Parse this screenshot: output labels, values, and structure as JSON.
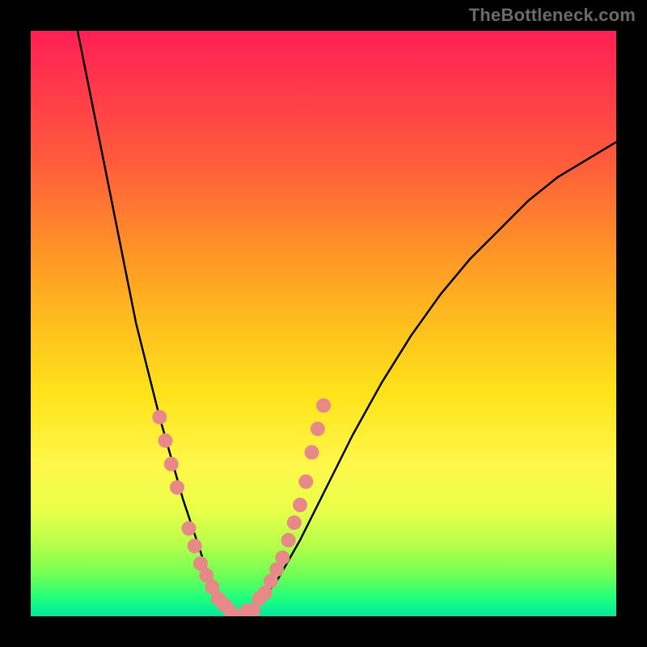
{
  "watermark": {
    "text": "TheBottleneck.com"
  },
  "chart_data": {
    "type": "line",
    "title": "",
    "xlabel": "",
    "ylabel": "",
    "xlim": [
      0,
      100
    ],
    "ylim": [
      0,
      100
    ],
    "series": [
      {
        "name": "bottleneck-curve",
        "x": [
          8,
          10,
          12,
          14,
          16,
          18,
          20,
          22,
          24,
          26,
          28,
          30,
          32,
          34,
          36,
          38,
          42,
          46,
          50,
          55,
          60,
          65,
          70,
          75,
          80,
          85,
          90,
          95,
          100
        ],
        "y": [
          100,
          90,
          80,
          70,
          60,
          50,
          42,
          34,
          27,
          20,
          14,
          8,
          4,
          1,
          0,
          1,
          6,
          13,
          21,
          31,
          40,
          48,
          55,
          61,
          66,
          71,
          75,
          78,
          81
        ]
      }
    ],
    "markers": [
      {
        "x": 22,
        "y": 34
      },
      {
        "x": 23,
        "y": 30
      },
      {
        "x": 24,
        "y": 26
      },
      {
        "x": 25,
        "y": 22
      },
      {
        "x": 27,
        "y": 15
      },
      {
        "x": 28,
        "y": 12
      },
      {
        "x": 29,
        "y": 9
      },
      {
        "x": 30,
        "y": 7
      },
      {
        "x": 31,
        "y": 5
      },
      {
        "x": 32,
        "y": 3
      },
      {
        "x": 33,
        "y": 2
      },
      {
        "x": 34,
        "y": 1
      },
      {
        "x": 35,
        "y": 0
      },
      {
        "x": 36,
        "y": 0
      },
      {
        "x": 37,
        "y": 1
      },
      {
        "x": 38,
        "y": 1
      },
      {
        "x": 39,
        "y": 3
      },
      {
        "x": 40,
        "y": 4
      },
      {
        "x": 41,
        "y": 6
      },
      {
        "x": 42,
        "y": 8
      },
      {
        "x": 43,
        "y": 10
      },
      {
        "x": 44,
        "y": 13
      },
      {
        "x": 45,
        "y": 16
      },
      {
        "x": 46,
        "y": 19
      },
      {
        "x": 47,
        "y": 23
      },
      {
        "x": 48,
        "y": 28
      },
      {
        "x": 49,
        "y": 32
      },
      {
        "x": 50,
        "y": 36
      }
    ],
    "marker_color": "#e78a87",
    "curve_color": "#000000",
    "minimum_x": 35
  }
}
